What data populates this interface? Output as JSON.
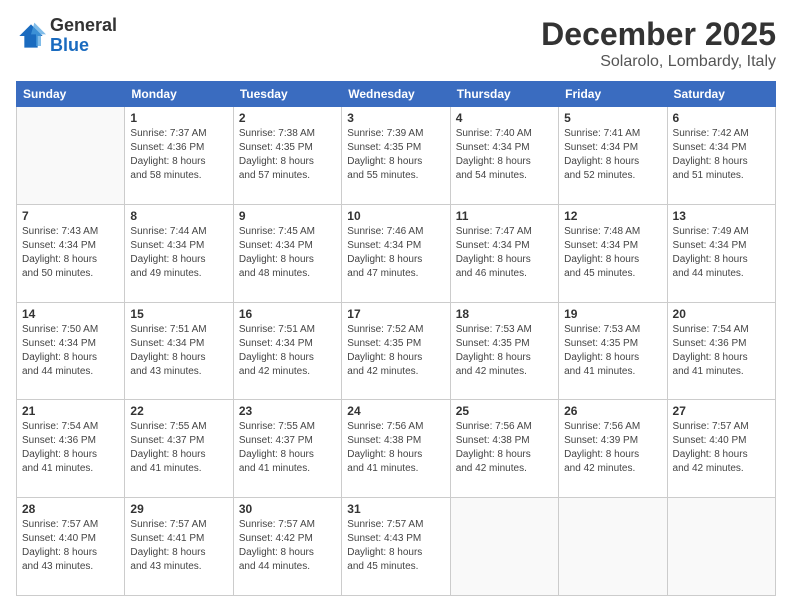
{
  "logo": {
    "general": "General",
    "blue": "Blue"
  },
  "header": {
    "month": "December 2025",
    "location": "Solarolo, Lombardy, Italy"
  },
  "weekdays": [
    "Sunday",
    "Monday",
    "Tuesday",
    "Wednesday",
    "Thursday",
    "Friday",
    "Saturday"
  ],
  "weeks": [
    [
      {
        "day": "",
        "info": ""
      },
      {
        "day": "1",
        "info": "Sunrise: 7:37 AM\nSunset: 4:36 PM\nDaylight: 8 hours\nand 58 minutes."
      },
      {
        "day": "2",
        "info": "Sunrise: 7:38 AM\nSunset: 4:35 PM\nDaylight: 8 hours\nand 57 minutes."
      },
      {
        "day": "3",
        "info": "Sunrise: 7:39 AM\nSunset: 4:35 PM\nDaylight: 8 hours\nand 55 minutes."
      },
      {
        "day": "4",
        "info": "Sunrise: 7:40 AM\nSunset: 4:34 PM\nDaylight: 8 hours\nand 54 minutes."
      },
      {
        "day": "5",
        "info": "Sunrise: 7:41 AM\nSunset: 4:34 PM\nDaylight: 8 hours\nand 52 minutes."
      },
      {
        "day": "6",
        "info": "Sunrise: 7:42 AM\nSunset: 4:34 PM\nDaylight: 8 hours\nand 51 minutes."
      }
    ],
    [
      {
        "day": "7",
        "info": "Sunrise: 7:43 AM\nSunset: 4:34 PM\nDaylight: 8 hours\nand 50 minutes."
      },
      {
        "day": "8",
        "info": "Sunrise: 7:44 AM\nSunset: 4:34 PM\nDaylight: 8 hours\nand 49 minutes."
      },
      {
        "day": "9",
        "info": "Sunrise: 7:45 AM\nSunset: 4:34 PM\nDaylight: 8 hours\nand 48 minutes."
      },
      {
        "day": "10",
        "info": "Sunrise: 7:46 AM\nSunset: 4:34 PM\nDaylight: 8 hours\nand 47 minutes."
      },
      {
        "day": "11",
        "info": "Sunrise: 7:47 AM\nSunset: 4:34 PM\nDaylight: 8 hours\nand 46 minutes."
      },
      {
        "day": "12",
        "info": "Sunrise: 7:48 AM\nSunset: 4:34 PM\nDaylight: 8 hours\nand 45 minutes."
      },
      {
        "day": "13",
        "info": "Sunrise: 7:49 AM\nSunset: 4:34 PM\nDaylight: 8 hours\nand 44 minutes."
      }
    ],
    [
      {
        "day": "14",
        "info": "Sunrise: 7:50 AM\nSunset: 4:34 PM\nDaylight: 8 hours\nand 44 minutes."
      },
      {
        "day": "15",
        "info": "Sunrise: 7:51 AM\nSunset: 4:34 PM\nDaylight: 8 hours\nand 43 minutes."
      },
      {
        "day": "16",
        "info": "Sunrise: 7:51 AM\nSunset: 4:34 PM\nDaylight: 8 hours\nand 42 minutes."
      },
      {
        "day": "17",
        "info": "Sunrise: 7:52 AM\nSunset: 4:35 PM\nDaylight: 8 hours\nand 42 minutes."
      },
      {
        "day": "18",
        "info": "Sunrise: 7:53 AM\nSunset: 4:35 PM\nDaylight: 8 hours\nand 42 minutes."
      },
      {
        "day": "19",
        "info": "Sunrise: 7:53 AM\nSunset: 4:35 PM\nDaylight: 8 hours\nand 41 minutes."
      },
      {
        "day": "20",
        "info": "Sunrise: 7:54 AM\nSunset: 4:36 PM\nDaylight: 8 hours\nand 41 minutes."
      }
    ],
    [
      {
        "day": "21",
        "info": "Sunrise: 7:54 AM\nSunset: 4:36 PM\nDaylight: 8 hours\nand 41 minutes."
      },
      {
        "day": "22",
        "info": "Sunrise: 7:55 AM\nSunset: 4:37 PM\nDaylight: 8 hours\nand 41 minutes."
      },
      {
        "day": "23",
        "info": "Sunrise: 7:55 AM\nSunset: 4:37 PM\nDaylight: 8 hours\nand 41 minutes."
      },
      {
        "day": "24",
        "info": "Sunrise: 7:56 AM\nSunset: 4:38 PM\nDaylight: 8 hours\nand 41 minutes."
      },
      {
        "day": "25",
        "info": "Sunrise: 7:56 AM\nSunset: 4:38 PM\nDaylight: 8 hours\nand 42 minutes."
      },
      {
        "day": "26",
        "info": "Sunrise: 7:56 AM\nSunset: 4:39 PM\nDaylight: 8 hours\nand 42 minutes."
      },
      {
        "day": "27",
        "info": "Sunrise: 7:57 AM\nSunset: 4:40 PM\nDaylight: 8 hours\nand 42 minutes."
      }
    ],
    [
      {
        "day": "28",
        "info": "Sunrise: 7:57 AM\nSunset: 4:40 PM\nDaylight: 8 hours\nand 43 minutes."
      },
      {
        "day": "29",
        "info": "Sunrise: 7:57 AM\nSunset: 4:41 PM\nDaylight: 8 hours\nand 43 minutes."
      },
      {
        "day": "30",
        "info": "Sunrise: 7:57 AM\nSunset: 4:42 PM\nDaylight: 8 hours\nand 44 minutes."
      },
      {
        "day": "31",
        "info": "Sunrise: 7:57 AM\nSunset: 4:43 PM\nDaylight: 8 hours\nand 45 minutes."
      },
      {
        "day": "",
        "info": ""
      },
      {
        "day": "",
        "info": ""
      },
      {
        "day": "",
        "info": ""
      }
    ]
  ]
}
